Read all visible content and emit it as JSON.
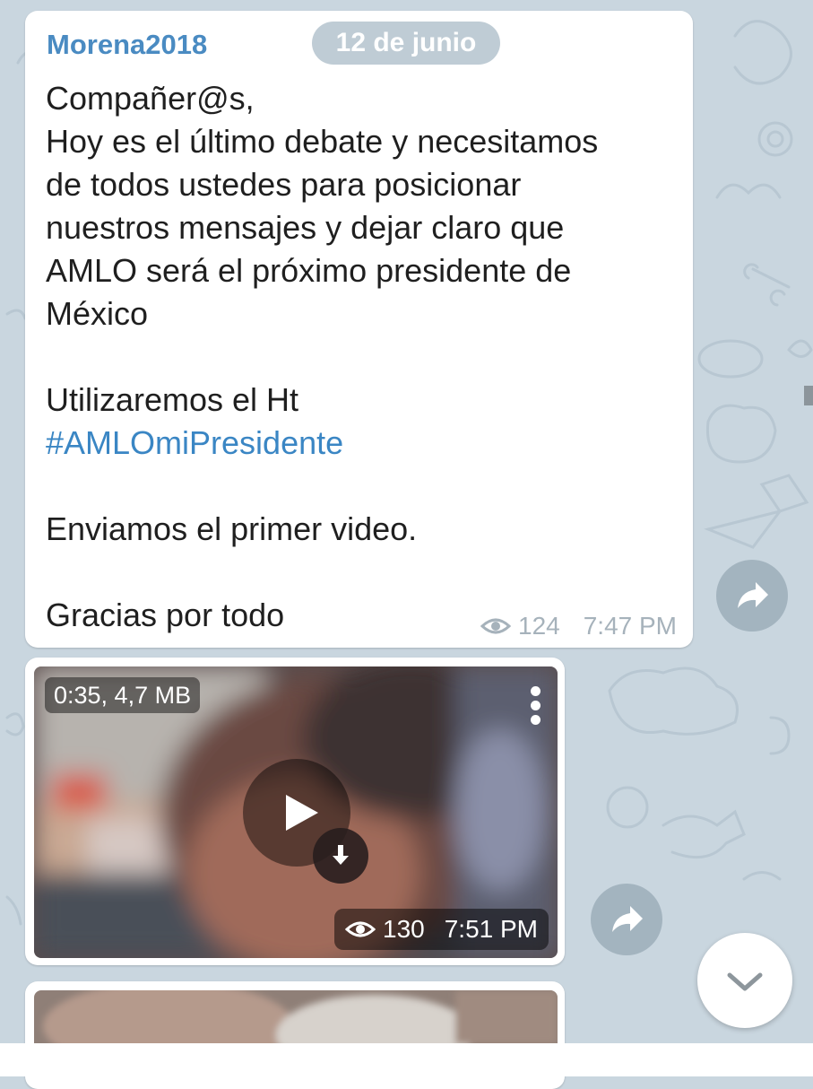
{
  "colors": {
    "chat_background": "#c9d6df",
    "sender_name": "#4a8bc2",
    "hashtag": "#3a86c4",
    "meta_text": "#a6b2bb"
  },
  "date_separator": "12 de junio",
  "messages": [
    {
      "sender": "Morena2018",
      "lines": [
        "Compañer@s,",
        "Hoy es el último debate y necesitamos",
        "de todos ustedes para posicionar",
        "nuestros mensajes y dejar claro que",
        "AMLO será el próximo presidente de",
        "México",
        "",
        "Utilizaremos  el Ht",
        "#AMLOmiPresidente",
        "",
        "Enviamos el primer video.",
        "",
        "Gracias por todo"
      ],
      "views": "124",
      "time": "7:47 PM"
    },
    {
      "type": "video",
      "video_info": "0:35, 4,7 MB",
      "views": "130",
      "time": "7:51 PM"
    },
    {
      "type": "photo"
    }
  ],
  "icons": {
    "views": "eye-icon",
    "share": "share-arrow-icon",
    "menu": "more-vertical-icon",
    "play": "play-icon",
    "download": "download-icon",
    "scroll": "chevron-down-icon"
  }
}
